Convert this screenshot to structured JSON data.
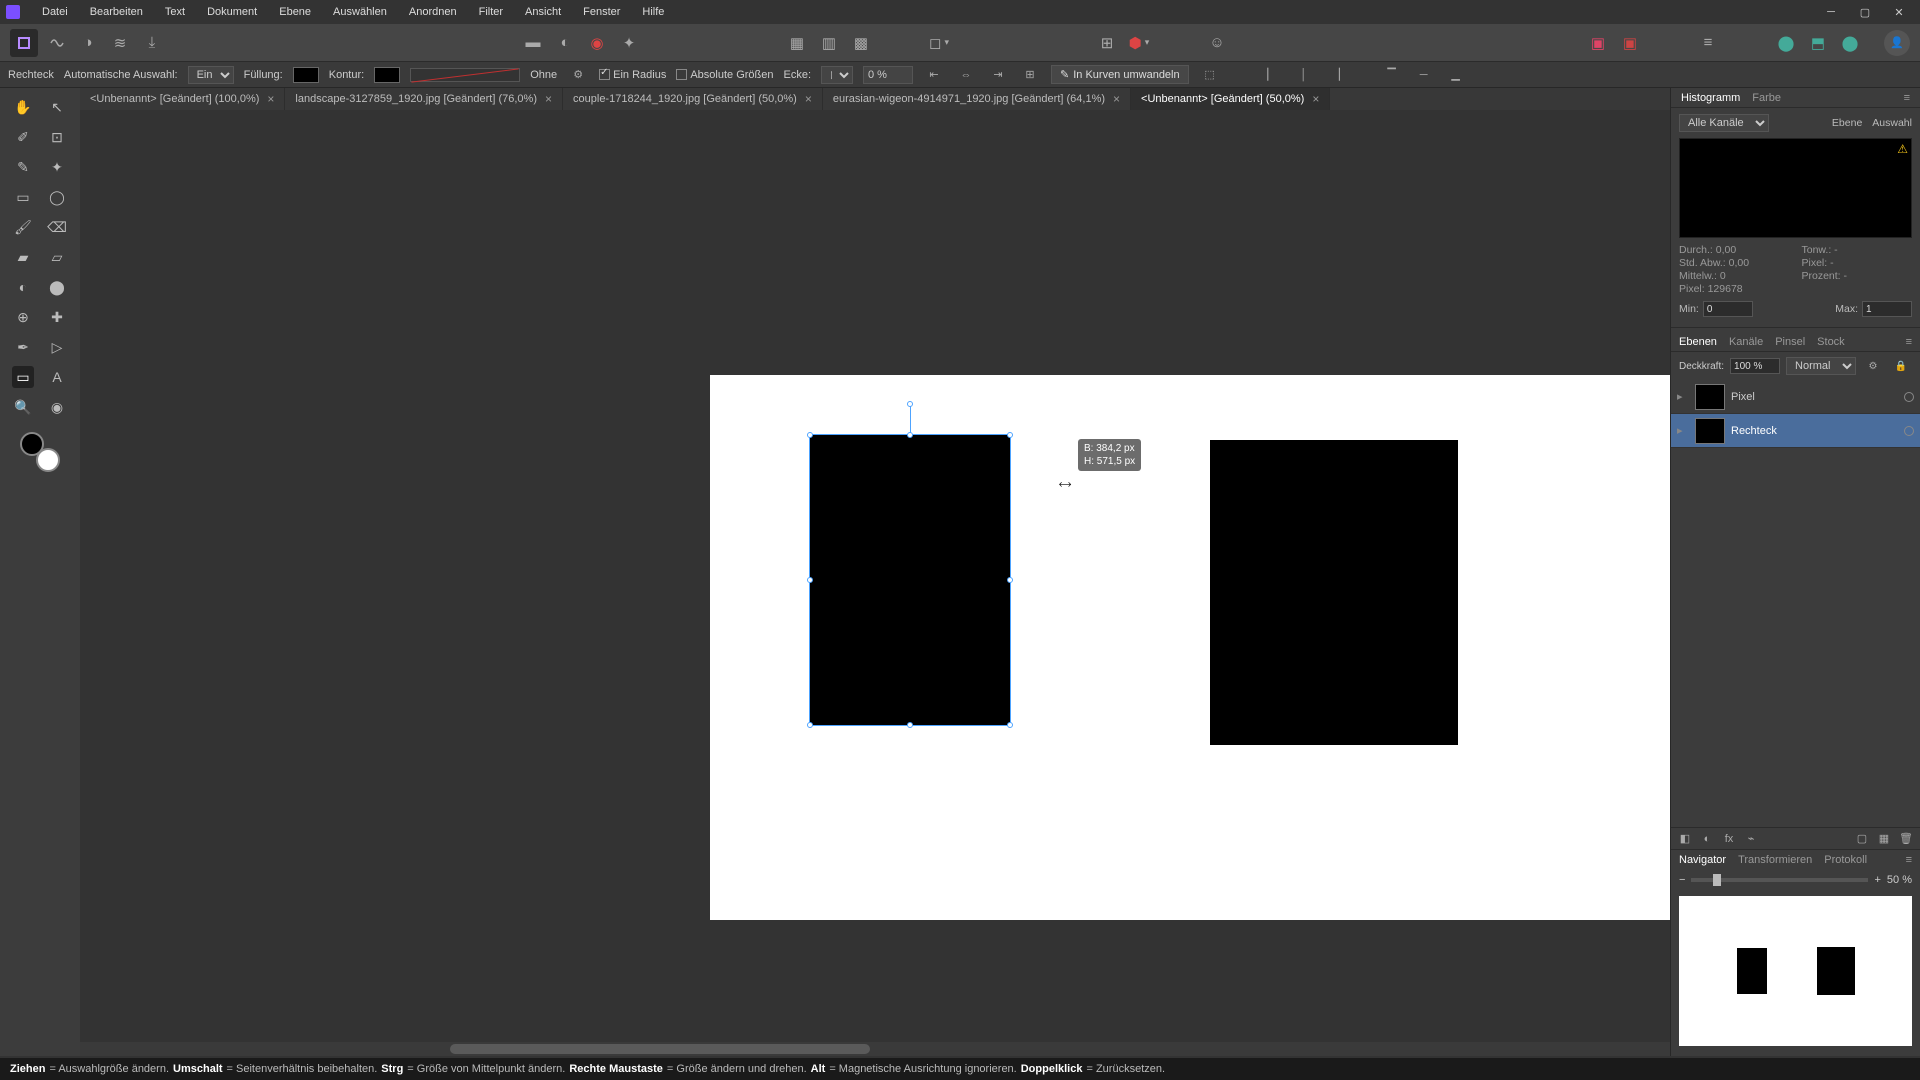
{
  "menu": [
    "Datei",
    "Bearbeiten",
    "Text",
    "Dokument",
    "Ebene",
    "Auswählen",
    "Anordnen",
    "Filter",
    "Ansicht",
    "Fenster",
    "Hilfe"
  ],
  "contextbar": {
    "tool": "Rechteck",
    "autosel_label": "Automatische Auswahl:",
    "autosel_value": "Ein",
    "fill_label": "Füllung:",
    "stroke_label": "Kontur:",
    "stroke_none": "Ohne",
    "single_radius": "Ein Radius",
    "abs_sizes": "Absolute Größen",
    "corner_label": "Ecke:",
    "corner_value": "0 %",
    "to_curves": "In Kurven umwandeln"
  },
  "tabs": [
    {
      "label": "<Unbenannt> [Geändert] (100,0%)",
      "active": false
    },
    {
      "label": "landscape-3127859_1920.jpg [Geändert] (76,0%)",
      "active": false
    },
    {
      "label": "couple-1718244_1920.jpg [Geändert] (50,0%)",
      "active": false
    },
    {
      "label": "eurasian-wigeon-4914971_1920.jpg [Geändert] (64,1%)",
      "active": false
    },
    {
      "label": "<Unbenannt> [Geändert] (50,0%)",
      "active": true
    }
  ],
  "dim_tooltip": {
    "w": "B: 384,2 px",
    "h": "H: 571,5 px"
  },
  "hist": {
    "tabs": [
      "Histogramm",
      "Farbe"
    ],
    "channel": "Alle Kanäle",
    "scope": [
      "Ebene",
      "Auswahl"
    ],
    "stats": {
      "mean": "Durch.: 0,00",
      "std": "Std. Abw.: 0,00",
      "median": "Mittelw.: 0",
      "pixels": "Pixel: 129678",
      "tone": "Tonw.: -",
      "pixelr": "Pixel: -",
      "percent": "Prozent: -"
    },
    "min_label": "Min:",
    "min": "0",
    "max_label": "Max:",
    "max": "1"
  },
  "layers": {
    "tabs": [
      "Ebenen",
      "Kanäle",
      "Pinsel",
      "Stock"
    ],
    "opacity_label": "Deckkraft:",
    "opacity": "100 %",
    "blend": "Normal",
    "items": [
      {
        "name": "Pixel",
        "sel": false
      },
      {
        "name": "Rechteck",
        "sel": true
      }
    ]
  },
  "nav": {
    "tabs": [
      "Navigator",
      "Transformieren",
      "Protokoll"
    ],
    "zoom": "50 %"
  },
  "status": {
    "parts": [
      {
        "b": "Ziehen",
        "t": " = Auswahlgröße ändern. "
      },
      {
        "b": "Umschalt",
        "t": " = Seitenverhältnis beibehalten. "
      },
      {
        "b": "Strg",
        "t": " = Größe von Mittelpunkt ändern. "
      },
      {
        "b": "Rechte Maustaste",
        "t": " = Größe ändern und drehen. "
      },
      {
        "b": "Alt",
        "t": " = Magnetische Ausrichtung ignorieren. "
      },
      {
        "b": "Doppelklick",
        "t": " = Zurücksetzen."
      }
    ]
  }
}
